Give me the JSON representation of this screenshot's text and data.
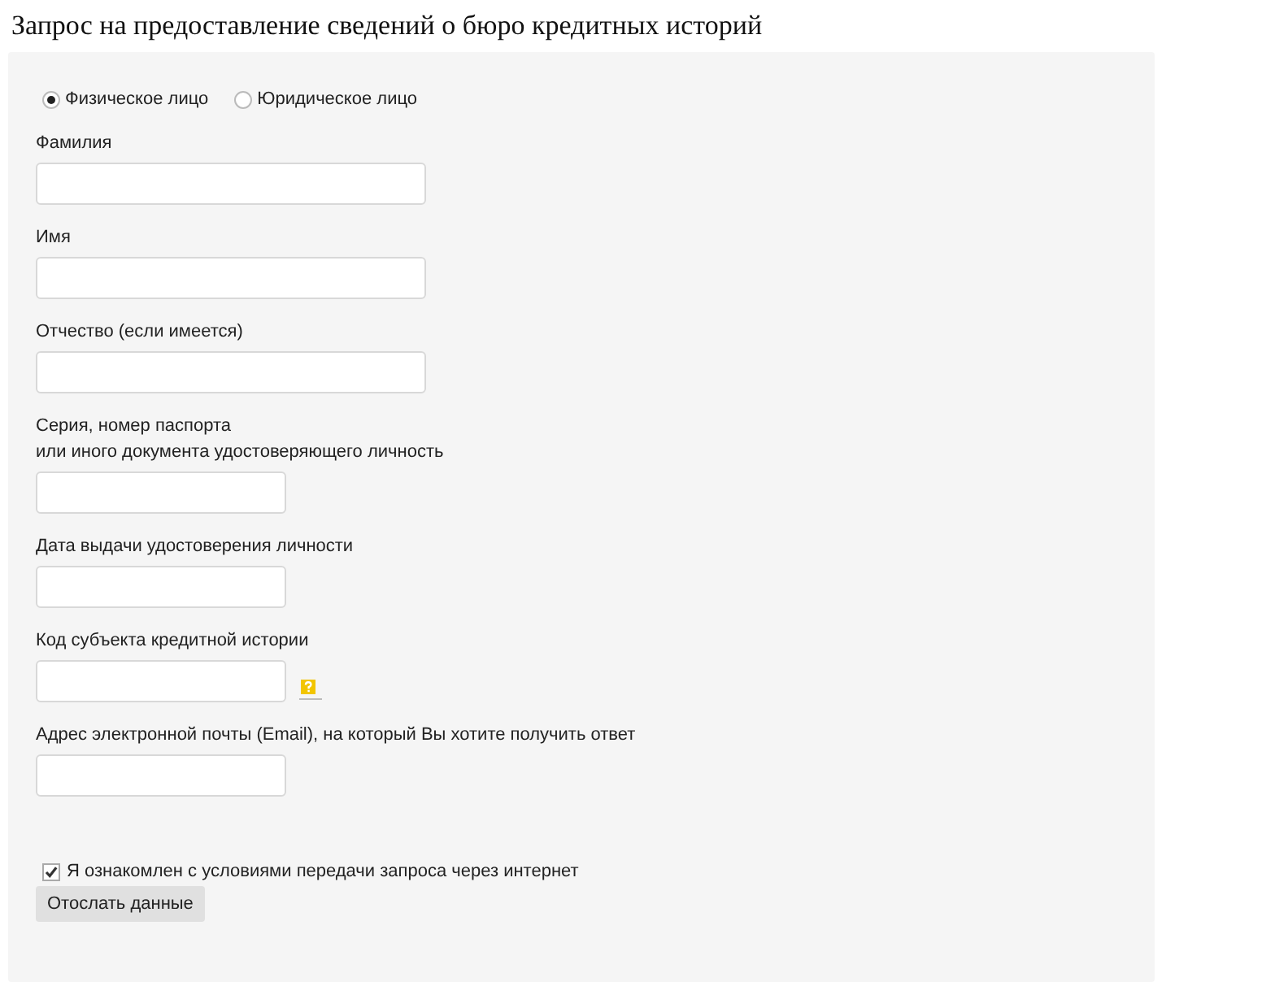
{
  "page_title": "Запрос на предоставление сведений о бюро кредитных историй",
  "person_type": [
    {
      "label": "Физическое лицо",
      "selected": true
    },
    {
      "label": "Юридическое лицо",
      "selected": false
    }
  ],
  "fields": [
    {
      "label": "Фамилия",
      "kind": "wide",
      "help": false
    },
    {
      "label": "Имя",
      "kind": "wide",
      "help": false
    },
    {
      "label": "Отчество (если имеется)",
      "kind": "wide",
      "help": false
    },
    {
      "label": "Серия, номер паспорта\nили иного документа удостоверяющего личность",
      "kind": "narrow",
      "help": false
    },
    {
      "label": "Дата выдачи удостоверения личности",
      "kind": "narrow",
      "help": false
    },
    {
      "label": "Код субъекта кредитной истории",
      "kind": "narrow",
      "help": true
    },
    {
      "label": "Адрес электронной почты (Email), на который Вы хотите получить ответ",
      "kind": "narrow",
      "help": false
    }
  ],
  "agreement": {
    "label": "Я ознакомлен с условиями передачи запроса через интернет",
    "checked": true
  },
  "submit_button": "Отослать данные"
}
